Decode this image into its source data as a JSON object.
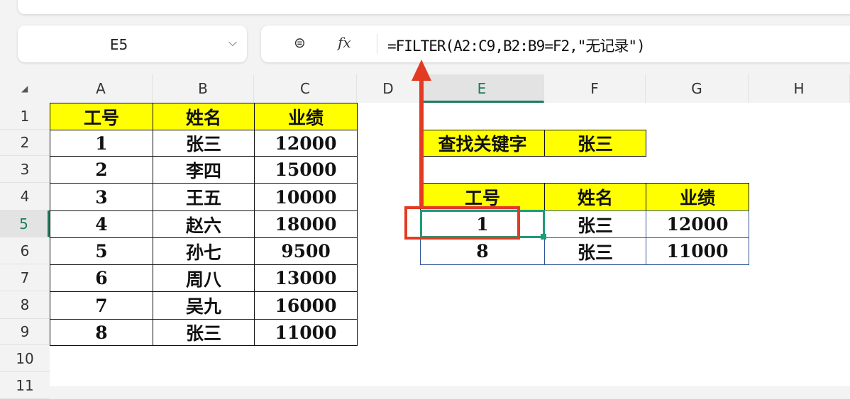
{
  "name_box": {
    "value": "E5"
  },
  "formula_bar": {
    "zoom_icon": "zoom-icon",
    "fx_label": "fx",
    "formula": "=FILTER(A2:C9,B2:B9=F2,\"无记录\")"
  },
  "columns": [
    "A",
    "B",
    "C",
    "D",
    "E",
    "F",
    "G",
    "H"
  ],
  "rows": [
    "1",
    "2",
    "3",
    "4",
    "5",
    "6",
    "7",
    "8",
    "9",
    "10",
    "11"
  ],
  "selected": {
    "column": "E",
    "row": "5"
  },
  "source_table": {
    "headers": [
      "工号",
      "姓名",
      "业绩"
    ],
    "rows": [
      [
        "1",
        "张三",
        "12000"
      ],
      [
        "2",
        "李四",
        "15000"
      ],
      [
        "3",
        "王五",
        "10000"
      ],
      [
        "4",
        "赵六",
        "18000"
      ],
      [
        "5",
        "孙七",
        "9500"
      ],
      [
        "6",
        "周八",
        "13000"
      ],
      [
        "7",
        "吴九",
        "16000"
      ],
      [
        "8",
        "张三",
        "11000"
      ]
    ]
  },
  "lookup": {
    "label": "查找关键字",
    "value": "张三"
  },
  "result_table": {
    "headers": [
      "工号",
      "姓名",
      "业绩"
    ],
    "rows": [
      [
        "1",
        "张三",
        "12000"
      ],
      [
        "8",
        "张三",
        "11000"
      ]
    ]
  },
  "colors": {
    "highlight": "#ffff00",
    "annotation": "#e33b22",
    "selection": "#1e9c78"
  }
}
